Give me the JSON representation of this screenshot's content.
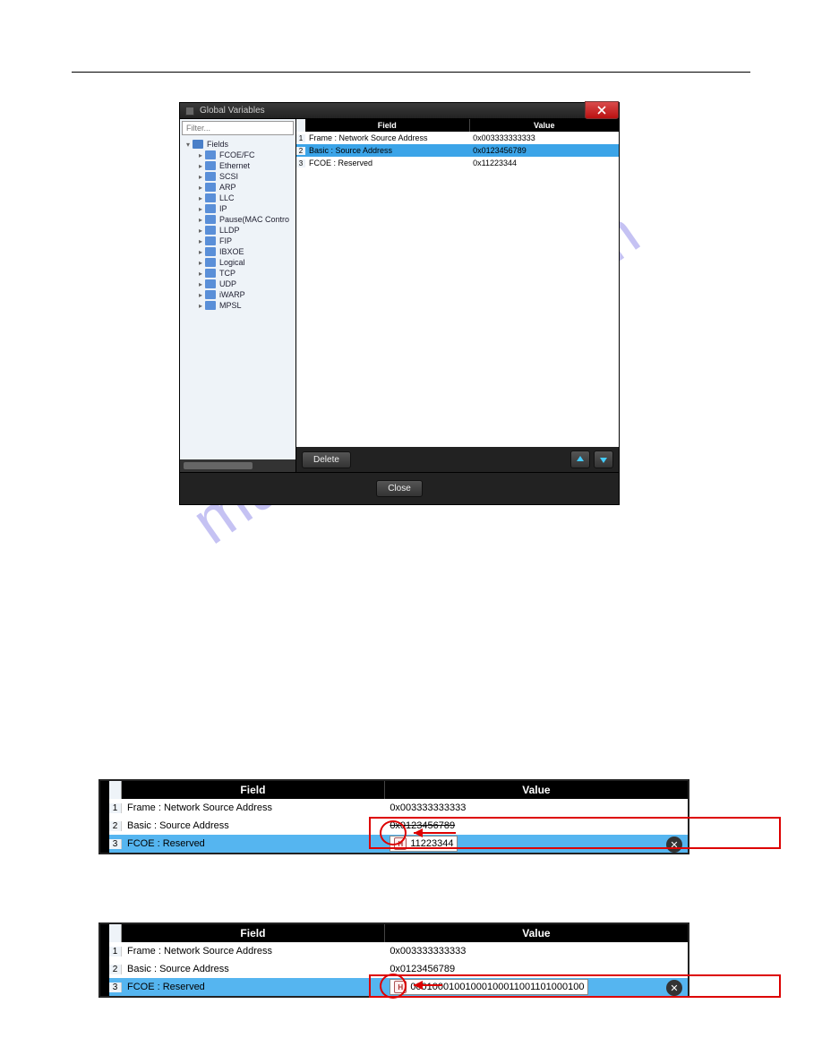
{
  "watermark": "manualshive.com",
  "dialog": {
    "title": "Global Variables",
    "filter_placeholder": "Filter...",
    "delete_label": "Delete",
    "close_label": "Close",
    "tree_root": "Fields",
    "tree_items": [
      "FCOE/FC",
      "Ethernet",
      "SCSI",
      "ARP",
      "LLC",
      "IP",
      "Pause(MAC Contro",
      "LLDP",
      "FIP",
      "IBXOE",
      "Logical",
      "TCP",
      "UDP",
      "iWARP",
      "MPSL"
    ],
    "head_field": "Field",
    "head_value": "Value",
    "rows": [
      {
        "n": "1",
        "field": "Frame : Network Source Address",
        "value": "0x003333333333",
        "sel": false
      },
      {
        "n": "2",
        "field": "Basic : Source Address",
        "value": "0x0123456789",
        "sel": true
      },
      {
        "n": "3",
        "field": "FCOE : Reserved",
        "value": "0x11223344",
        "sel": false
      }
    ]
  },
  "table1": {
    "head_field": "Field",
    "head_value": "Value",
    "rows": [
      {
        "n": "1",
        "field": "Frame : Network Source Address",
        "value": "0x003333333333",
        "sel": false
      },
      {
        "n": "2",
        "field": "Basic : Source Address",
        "value": "0x0123456789",
        "sel": false,
        "strike": true
      },
      {
        "n": "3",
        "field": "FCOE : Reserved",
        "value": "11223344",
        "sel": true,
        "edit": true
      }
    ]
  },
  "table2": {
    "head_field": "Field",
    "head_value": "Value",
    "rows": [
      {
        "n": "1",
        "field": "Frame : Network Source Address",
        "value": "0x003333333333",
        "sel": false
      },
      {
        "n": "2",
        "field": "Basic : Source Address",
        "value": "0x0123456789",
        "sel": false
      },
      {
        "n": "3",
        "field": "FCOE : Reserved",
        "value": "00010001001000100011001101000100",
        "sel": true,
        "edit": true
      }
    ]
  }
}
